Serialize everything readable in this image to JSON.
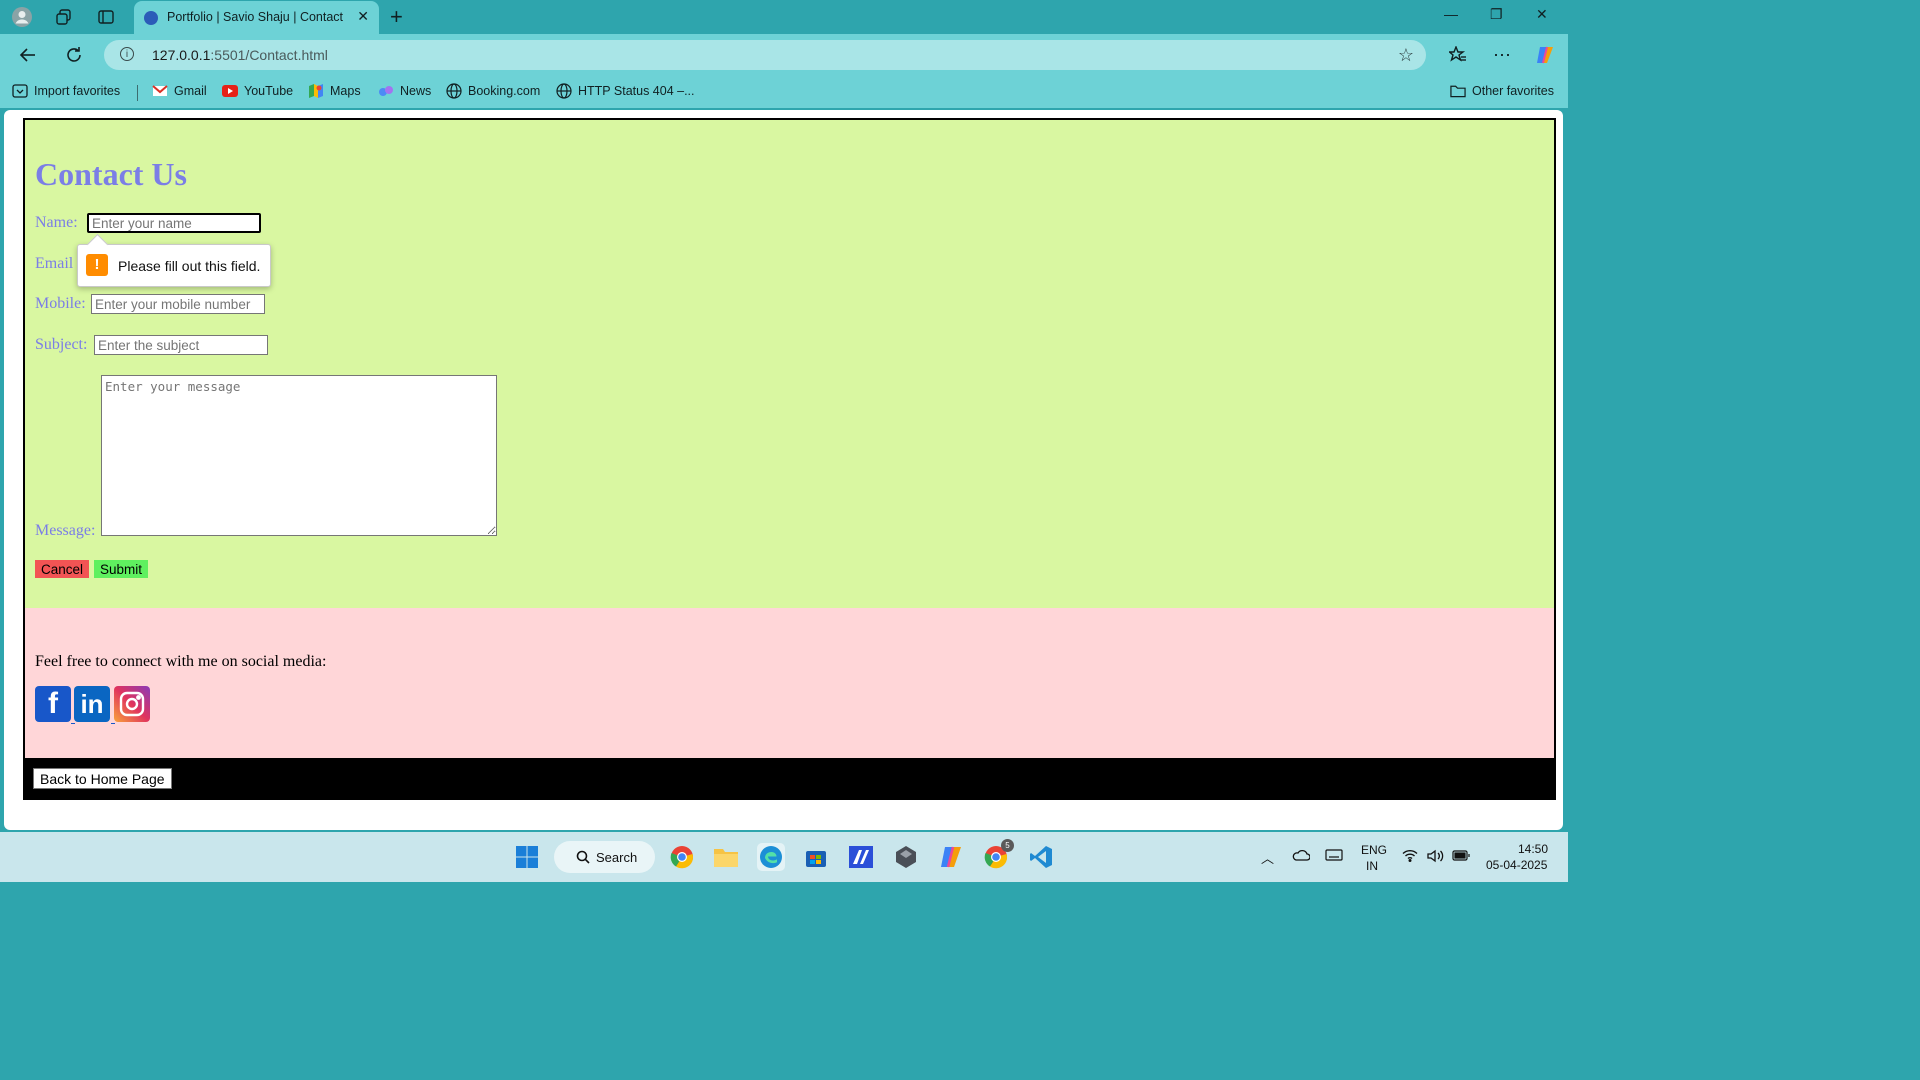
{
  "browser": {
    "tab_title": "Portfolio | Savio Shaju | Contact",
    "url_host": "127.0.0.1",
    "url_rest": ":5501/Contact.html"
  },
  "bookmarks": [
    {
      "label": "Import favorites",
      "icon": "import-icon"
    },
    {
      "label": "Gmail",
      "icon": "gmail-icon"
    },
    {
      "label": "YouTube",
      "icon": "youtube-icon"
    },
    {
      "label": "Maps",
      "icon": "maps-icon"
    },
    {
      "label": "News",
      "icon": "news-icon"
    },
    {
      "label": "Booking.com",
      "icon": "globe-icon"
    },
    {
      "label": "HTTP Status 404 –...",
      "icon": "globe-icon"
    },
    {
      "label": "Other favorites",
      "icon": "folder-icon"
    }
  ],
  "contact": {
    "heading": "Contact Us",
    "name_label": "Name:",
    "name_placeholder": "Enter your name",
    "email_label": "Email",
    "mobile_label": "Mobile:",
    "mobile_placeholder": "Enter your mobile number",
    "subject_label": "Subject:",
    "subject_placeholder": "Enter the subject",
    "message_label": "Message:",
    "message_placeholder": "Enter your message",
    "cancel_label": "Cancel",
    "submit_label": "Submit",
    "validation_message": "Please fill out this field."
  },
  "social": {
    "text": "Feel free to connect with me on social media:",
    "icons": [
      "facebook-icon",
      "linkedin-icon",
      "instagram-icon"
    ]
  },
  "footer": {
    "home_button": "Back to Home Page"
  },
  "taskbar": {
    "search_label": "Search",
    "language": "ENG",
    "region": "IN",
    "time": "14:50",
    "date": "05-04-2025",
    "chrome_badge": "5"
  },
  "colors": {
    "tab_bar": "#2ea5ad",
    "toolbar": "#6dd2d6",
    "contact_bg": "#d9f7a1",
    "social_bg": "#ffd6d8",
    "heading": "#7b7ee6",
    "cancel": "#f25454",
    "submit": "#5ff05f"
  }
}
